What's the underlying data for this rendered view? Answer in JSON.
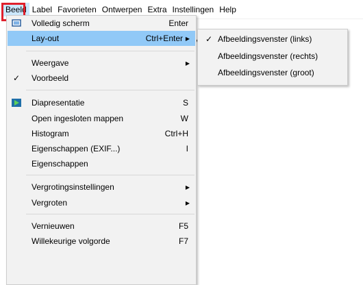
{
  "menubar": {
    "items": [
      "Beeld",
      "Label",
      "Favorieten",
      "Ontwerpen",
      "Extra",
      "Instellingen",
      "Help"
    ]
  },
  "beeld_menu": {
    "items": [
      {
        "label": "Volledig scherm",
        "shortcut": "Enter",
        "icon": "fullscreen-icon"
      },
      {
        "label": "Lay-out",
        "shortcut": "Ctrl+Enter",
        "submenu": true,
        "highlighted": true
      },
      {
        "label": "Weergave",
        "submenu": true
      },
      {
        "label": "Voorbeeld",
        "checked": true
      },
      {
        "label": "Diapresentatie",
        "shortcut": "S",
        "icon": "slideshow-icon"
      },
      {
        "label": "Open ingesloten mappen",
        "shortcut": "W"
      },
      {
        "label": "Histogram",
        "shortcut": "Ctrl+H"
      },
      {
        "label": "Eigenschappen (EXIF...)",
        "shortcut": "I"
      },
      {
        "label": "Eigenschappen"
      },
      {
        "label": "Vergrotingsinstellingen",
        "submenu": true
      },
      {
        "label": "Vergroten",
        "submenu": true
      },
      {
        "label": "Vernieuwen",
        "shortcut": "F5"
      },
      {
        "label": "Willekeurige volgorde",
        "shortcut": "F7"
      }
    ]
  },
  "layout_submenu": {
    "items": [
      {
        "label": "Afbeeldingsvenster (links)",
        "checked": true
      },
      {
        "label": "Afbeeldingsvenster (rechts)"
      },
      {
        "label": "Afbeeldingsvenster (groot)"
      }
    ]
  },
  "glyphs": {
    "check": "✓",
    "submenu_arrow": "▶",
    "dropdown_arrow": "▾"
  },
  "colors": {
    "menu_bg": "#f2f2f2",
    "highlight": "#91c9f7",
    "menubar_active": "#cce8ff",
    "annotation_box": "#e0202c"
  }
}
